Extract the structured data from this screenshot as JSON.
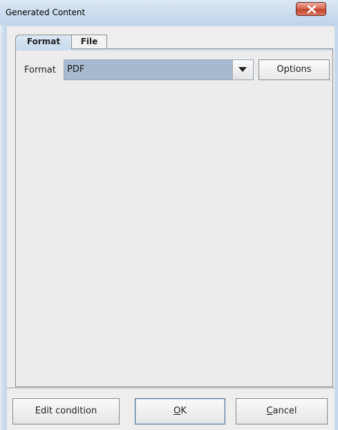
{
  "window": {
    "title": "Generated Content"
  },
  "tabs": [
    {
      "label": "Format",
      "selected": true
    },
    {
      "label": "File",
      "selected": false
    }
  ],
  "format": {
    "label": "Format",
    "selected_value": "PDF",
    "options_button": "Options"
  },
  "buttons": {
    "edit_condition": "Edit condition",
    "ok_mnemonic": "O",
    "ok_rest": "K",
    "cancel_mnemonic": "C",
    "cancel_rest": "ancel"
  },
  "colors": {
    "titlebar": "#c9dbee",
    "selection": "#a6b9cf",
    "close_button": "#c3432c"
  },
  "icons": {
    "close": "close-icon",
    "dropdown": "chevron-down-icon"
  }
}
